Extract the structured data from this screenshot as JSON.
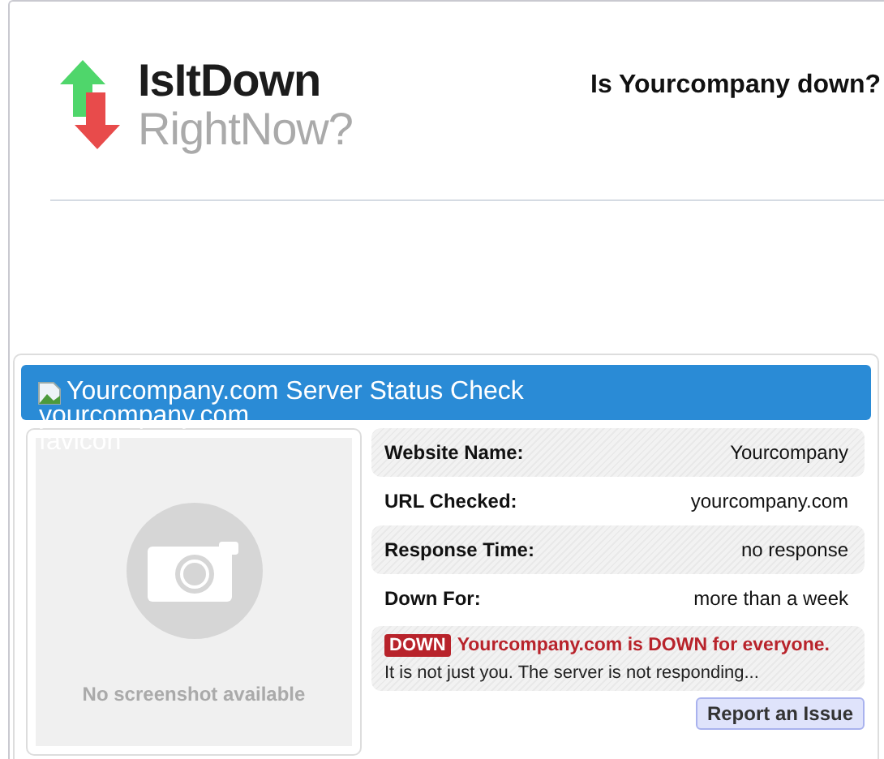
{
  "logo": {
    "line_1": "IsItDown",
    "line_2": "RightNow?"
  },
  "page_title": "Is Yourcompany down?",
  "status_card": {
    "title": "Yourcompany.com Server Status Check",
    "favicon_alt": "yourcompany.com favicon",
    "screenshot": {
      "caption": "No screenshot available"
    },
    "rows": [
      {
        "label": "Website Name:",
        "value": "Yourcompany"
      },
      {
        "label": "URL Checked:",
        "value": "yourcompany.com"
      },
      {
        "label": "Response Time:",
        "value": "no response"
      },
      {
        "label": "Down For:",
        "value": "more than a week"
      }
    ],
    "status": {
      "badge": "DOWN",
      "headline": "Yourcompany.com is DOWN for everyone.",
      "detail": "It is not just you. The server is not responding..."
    },
    "report_button": "Report an Issue"
  }
}
